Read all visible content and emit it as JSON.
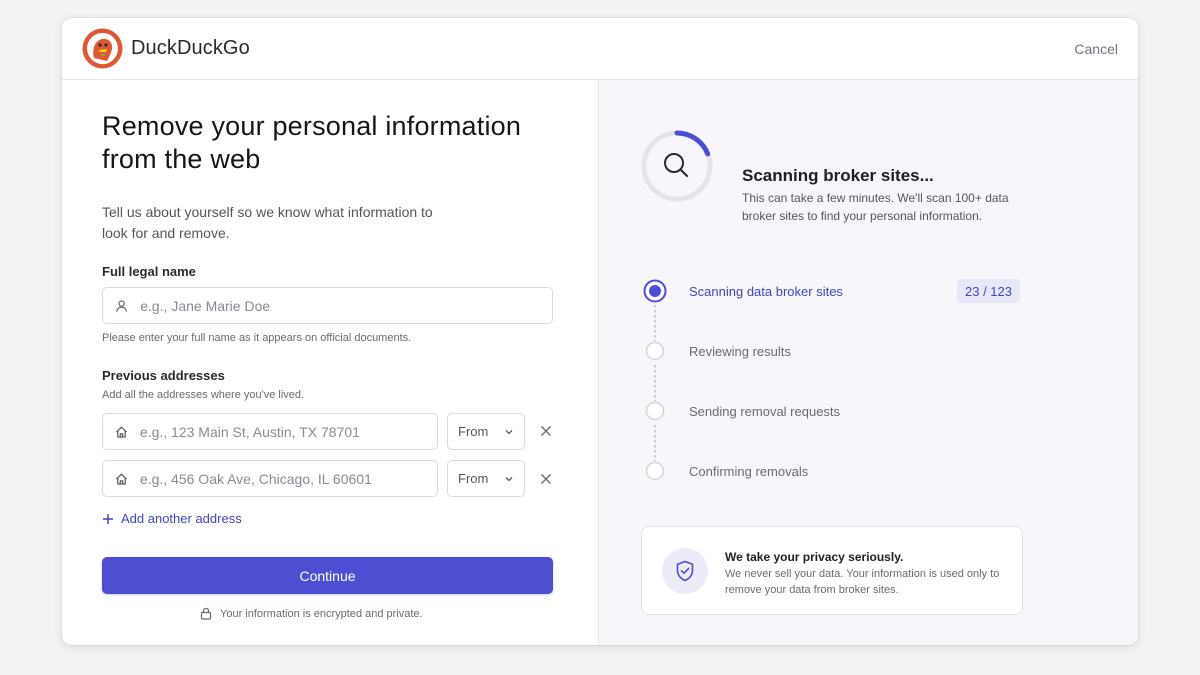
{
  "header": {
    "brand_name": "DuckDuckGo",
    "cancel_label": "Cancel"
  },
  "form": {
    "title": "Remove your personal information from the web",
    "subtitle": "Tell us about yourself so we know what information to look for and remove.",
    "name_label": "Full legal name",
    "name_placeholder": "e.g., Jane Marie Doe",
    "name_value": "",
    "name_hint": "Please enter your full name as it appears on official documents.",
    "addresses_label": "Previous addresses",
    "addresses_hint": "Add all the addresses where you've lived.",
    "addresses": [
      {
        "placeholder": "e.g., 123 Main St, Austin, TX 78701",
        "value": "",
        "from_label": "From"
      },
      {
        "placeholder": "e.g., 456 Oak Ave, Chicago, IL 60601",
        "value": "",
        "from_label": "From"
      }
    ],
    "add_address_label": "Add another address",
    "continue_label": "Continue",
    "secure_note": "Your information is encrypted and private."
  },
  "scan": {
    "title": "Scanning broker sites...",
    "description": "This can take a few minutes. We'll scan 100+ data broker sites to find your personal information.",
    "progress_fraction": 0.19,
    "steps": [
      {
        "label": "Scanning data broker sites",
        "state": "active",
        "counter": "23 / 123"
      },
      {
        "label": "Reviewing results",
        "state": "pending"
      },
      {
        "label": "Sending removal requests",
        "state": "pending"
      },
      {
        "label": "Confirming removals",
        "state": "pending"
      }
    ],
    "privacy_title": "We take your privacy seriously.",
    "privacy_text": "We never sell your data. Your information is used only to remove your data from broker sites."
  },
  "icons": {
    "logo": "duckduckgo-logo",
    "person": "person-icon",
    "home": "home-icon",
    "chevron": "chevron-down-icon",
    "close": "close-icon",
    "plus": "plus-icon",
    "lock": "lock-icon",
    "search": "search-icon",
    "shield": "shield-check-icon"
  },
  "colors": {
    "accent": "#4c4fd1",
    "accent_text": "#3e45c4",
    "logo_orange": "#de5833"
  }
}
